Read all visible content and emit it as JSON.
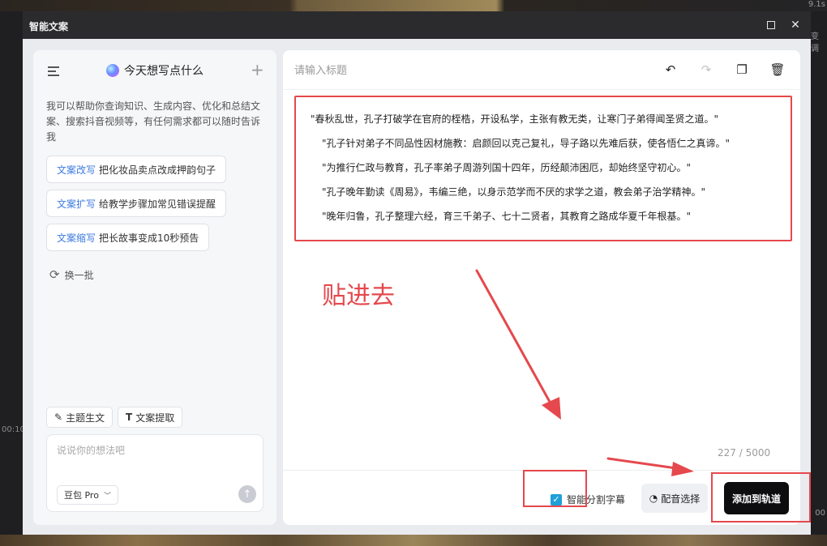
{
  "background": {
    "right_texts": [
      "9.1s",
      "变调"
    ],
    "left_texts": [
      "00:10"
    ],
    "right_bottom_text": "00"
  },
  "dialog": {
    "title": "智能文案",
    "maximize_icon": "maximize-icon",
    "close_icon": "close-icon"
  },
  "left_panel": {
    "header_title": "今天想写点什么",
    "description": "我可以帮助你查询知识、生成内容、优化和总结文案、搜索抖音视频等，有任何需求都可以随时告诉我",
    "suggestions": [
      {
        "tag": "文案改写",
        "text": "把化妆品卖点改成押韵句子"
      },
      {
        "tag": "文案扩写",
        "text": "给教学步骤加常见错误提醒"
      },
      {
        "tag": "文案缩写",
        "text": "把长故事变成10秒预告"
      }
    ],
    "refresh_label": "换一批",
    "tools": [
      {
        "label": "主题生文",
        "icon": "magic-wand-icon"
      },
      {
        "label": "文案提取",
        "icon": "text-icon"
      }
    ],
    "input_placeholder": "说说你的想法吧",
    "model_label": "豆包 Pro"
  },
  "right_panel": {
    "title_placeholder": "请输入标题",
    "content_lines": [
      "\"春秋乱世，孔子打破学在官府的桎梏，开设私学，主张有教无类，让寒门子弟得闻圣贤之道。\"",
      "\"孔子针对弟子不同品性因材施教：启颜回以克己复礼，导子路以先难后获，使各悟仁之真谛。\"",
      "\"为推行仁政与教育，孔子率弟子周游列国十四年，历经颠沛困厄，却始终坚守初心。\"",
      "\"孔子晚年勤读《周易》，韦编三绝，以身示范学而不厌的求学之道，教会弟子治学精神。\"",
      "\"晚年归鲁，孔子整理六经，育三千弟子、七十二贤者，其教育之路成华夏千年根基。\""
    ],
    "annotation": "贴进去",
    "counter": "227 / 5000",
    "checkbox_label": "智能分割字幕",
    "checkbox_checked": true,
    "voice_button": "配音选择",
    "add_button": "添加到轨道"
  },
  "colors": {
    "annotation_red": "#e5484d",
    "accent_blue": "#3d7be0",
    "checkbox_blue": "#1fa0d8",
    "primary_button": "#0d0d10"
  }
}
